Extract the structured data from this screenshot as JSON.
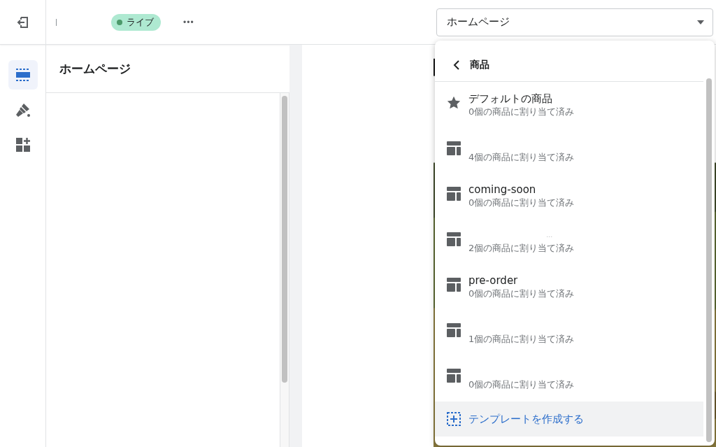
{
  "topbar": {
    "status_badge": "ライブ",
    "more_menu": "•••"
  },
  "rail": [
    {
      "kind": "sections",
      "selected": true
    },
    {
      "kind": "brush",
      "selected": false
    },
    {
      "kind": "apps",
      "selected": false
    }
  ],
  "panel": {
    "title": "ホームページ"
  },
  "page_select": {
    "value": "ホームページ"
  },
  "dropdown": {
    "back_label": "商品",
    "items": [
      {
        "kind": "default",
        "title": "デフォルトの商品",
        "subtitle": "0個の商品に割り当て済み"
      },
      {
        "kind": "template",
        "subtitle": "4個の商品に割り当て済み"
      },
      {
        "kind": "template",
        "title": "coming-soon",
        "subtitle": "0個の商品に割り当て済み"
      },
      {
        "kind": "template",
        "title": "…",
        "subtitle": "2個の商品に割り当て済み"
      },
      {
        "kind": "template",
        "title": "pre-order",
        "subtitle": "0個の商品に割り当て済み"
      },
      {
        "kind": "template",
        "subtitle": "1個の商品に割り当て済み"
      },
      {
        "kind": "template",
        "subtitle": "0個の商品に割り当て済み"
      }
    ],
    "create_label": "テンプレートを作成する"
  }
}
